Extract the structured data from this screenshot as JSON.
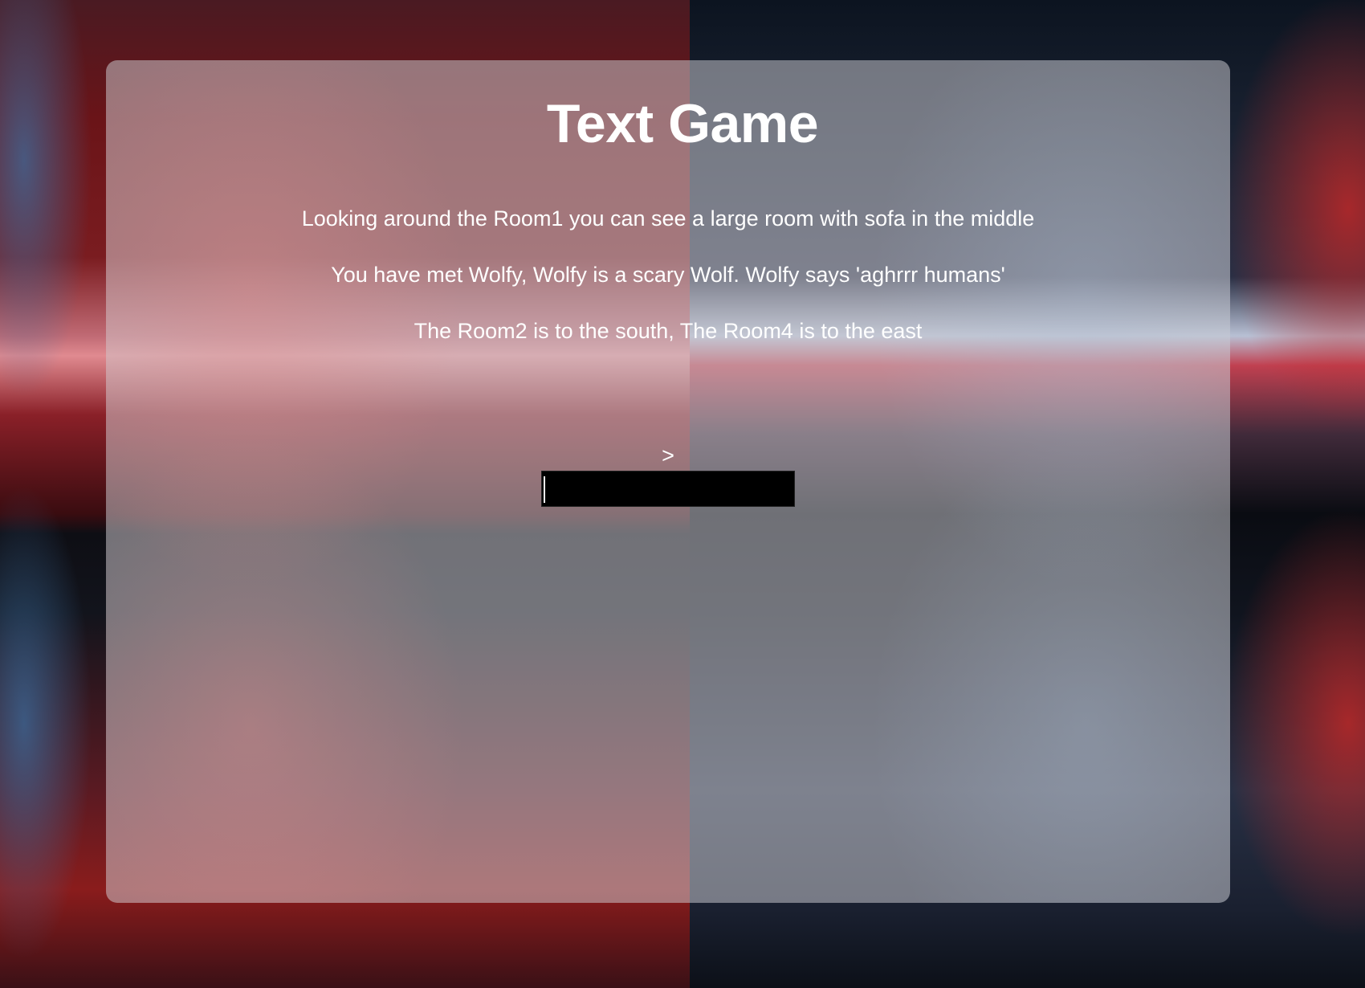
{
  "game": {
    "title": "Text Game",
    "messages": [
      "Looking around the Room1 you can see a large room with sofa in the middle",
      "You have met Wolfy, Wolfy is a scary Wolf. Wolfy says 'aghrrr humans'",
      "The Room2 is to the south, The Room4 is to the east"
    ],
    "prompt_symbol": ">",
    "command_input": {
      "value": "",
      "placeholder": ""
    }
  },
  "colors": {
    "panel": "#cdcdd2",
    "text": "#ffffff",
    "input_background": "#000000"
  }
}
